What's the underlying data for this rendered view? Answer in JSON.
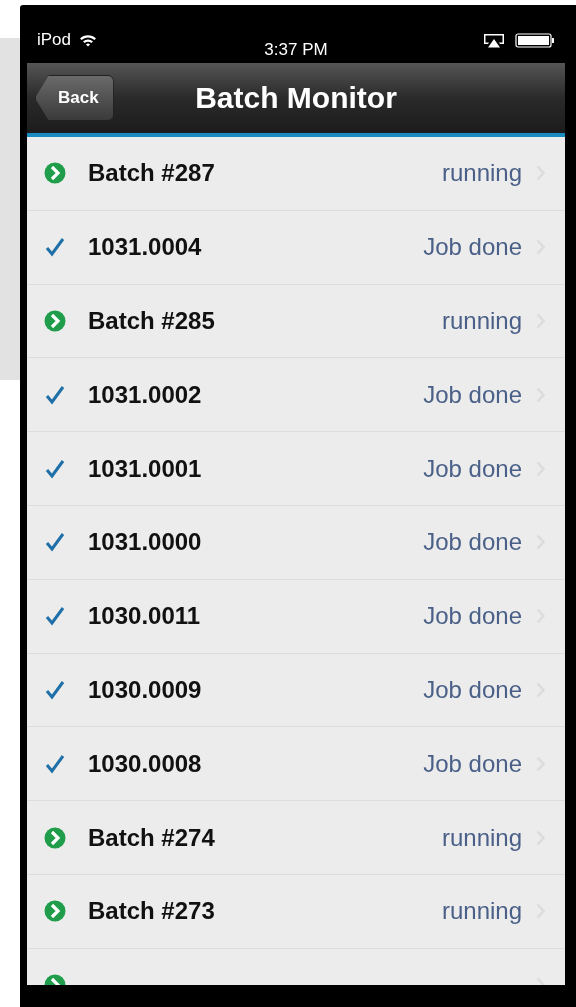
{
  "status_bar": {
    "carrier": "iPod",
    "time": "3:37 PM"
  },
  "nav_bar": {
    "back": "Back",
    "title": "Batch Monitor"
  },
  "rows": [
    {
      "kind": "running",
      "name": "Batch #287",
      "status": "running"
    },
    {
      "kind": "done",
      "name": "1031.0004",
      "status": "Job done"
    },
    {
      "kind": "running",
      "name": "Batch #285",
      "status": "running"
    },
    {
      "kind": "done",
      "name": "1031.0002",
      "status": "Job done"
    },
    {
      "kind": "done",
      "name": "1031.0001",
      "status": "Job done"
    },
    {
      "kind": "done",
      "name": "1031.0000",
      "status": "Job done"
    },
    {
      "kind": "done",
      "name": "1030.0011",
      "status": "Job done"
    },
    {
      "kind": "done",
      "name": "1030.0009",
      "status": "Job done"
    },
    {
      "kind": "done",
      "name": "1030.0008",
      "status": "Job done"
    },
    {
      "kind": "running",
      "name": "Batch #274",
      "status": "running"
    },
    {
      "kind": "running",
      "name": "Batch #273",
      "status": "running"
    },
    {
      "kind": "running"
    }
  ]
}
